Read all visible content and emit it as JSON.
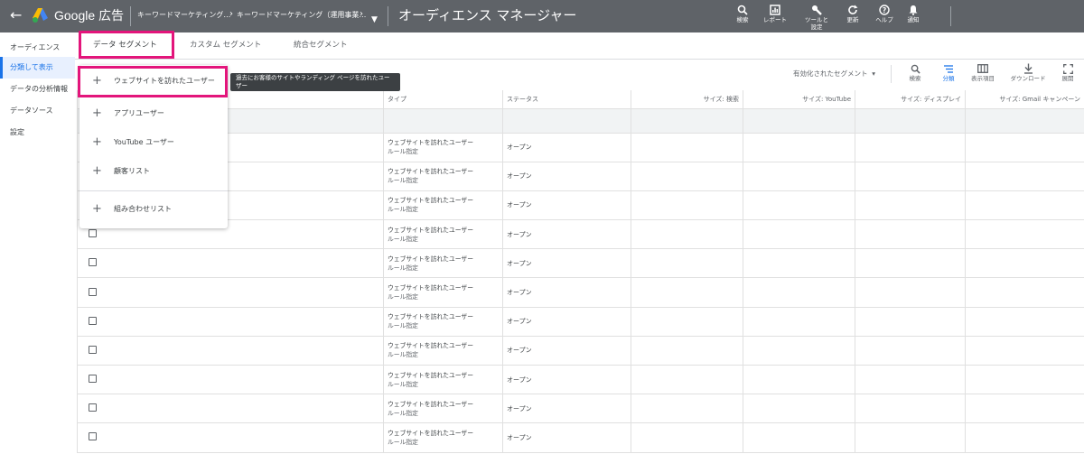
{
  "topbar": {
    "brand": "Google 広告",
    "breadcrumb1": "キーワードマーケティング…",
    "breadcrumb2": "キーワードマーケティング（運用事業…",
    "page_title": "オーディエンス マネージャー",
    "tools": [
      {
        "label": "検索",
        "icon": "search-icon"
      },
      {
        "label": "レポート",
        "icon": "report-icon"
      },
      {
        "label": "ツールと\n設定",
        "icon": "wrench-icon"
      },
      {
        "label": "更新",
        "icon": "refresh-icon"
      },
      {
        "label": "ヘルプ",
        "icon": "help-icon"
      },
      {
        "label": "通知",
        "icon": "bell-icon"
      }
    ]
  },
  "leftnav": {
    "items": [
      "オーディエンス",
      "分類して表示",
      "データの分析情報",
      "データソース",
      "設定"
    ],
    "active_index": 1
  },
  "tabs": [
    "データ セグメント",
    "カスタム セグメント",
    "統合セグメント"
  ],
  "toolbar": {
    "segment_filter": "有効化されたセグメント",
    "icons": [
      {
        "label": "検索",
        "icon": "search-icon"
      },
      {
        "label": "分類",
        "icon": "segment-icon"
      },
      {
        "label": "表示項目",
        "icon": "columns-icon"
      },
      {
        "label": "ダウンロード",
        "icon": "download-icon"
      },
      {
        "label": "展開",
        "icon": "fullscreen-icon"
      }
    ]
  },
  "menu": {
    "items": [
      "ウェブサイトを訪れたユーザー",
      "アプリユーザー",
      "YouTube ユーザー",
      "顧客リスト",
      "組み合わせリスト"
    ],
    "tooltip": "過去にお客様のサイトやランディング ページを訪れたユーザー"
  },
  "table": {
    "headers": [
      "",
      "タイプ",
      "ステータス",
      "サイズ: 検索",
      "サイズ: YouTube",
      "サイズ: ディスプレイ",
      "サイズ: Gmail キャンペーン"
    ],
    "rows": [
      {
        "type": "ウェブサイトを訪れたユーザー",
        "type_sub": "ルール指定",
        "status": "オープン",
        "checkbox": false
      },
      {
        "type": "ウェブサイトを訪れたユーザー",
        "type_sub": "ルール指定",
        "status": "オープン",
        "checkbox": false
      },
      {
        "type": "ウェブサイトを訪れたユーザー",
        "type_sub": "ルール指定",
        "status": "オープン",
        "checkbox": false
      },
      {
        "type": "ウェブサイトを訪れたユーザー",
        "type_sub": "ルール指定",
        "status": "オープン",
        "checkbox": true
      },
      {
        "type": "ウェブサイトを訪れたユーザー",
        "type_sub": "ルール指定",
        "status": "オープン",
        "checkbox": true
      },
      {
        "type": "ウェブサイトを訪れたユーザー",
        "type_sub": "ルール指定",
        "status": "オープン",
        "checkbox": true
      },
      {
        "type": "ウェブサイトを訪れたユーザー",
        "type_sub": "ルール指定",
        "status": "オープン",
        "checkbox": true
      },
      {
        "type": "ウェブサイトを訪れたユーザー",
        "type_sub": "ルール指定",
        "status": "オープン",
        "checkbox": true
      },
      {
        "type": "ウェブサイトを訪れたユーザー",
        "type_sub": "ルール指定",
        "status": "オープン",
        "checkbox": true
      },
      {
        "type": "ウェブサイトを訪れたユーザー",
        "type_sub": "ルール指定",
        "status": "オープン",
        "checkbox": true
      },
      {
        "type": "ウェブサイトを訪れたユーザー",
        "type_sub": "ルール指定",
        "status": "オープン",
        "checkbox": true
      }
    ]
  },
  "colors": {
    "highlight": "#e3157b",
    "accent": "#1a73e8",
    "topbar": "#5f6368"
  }
}
